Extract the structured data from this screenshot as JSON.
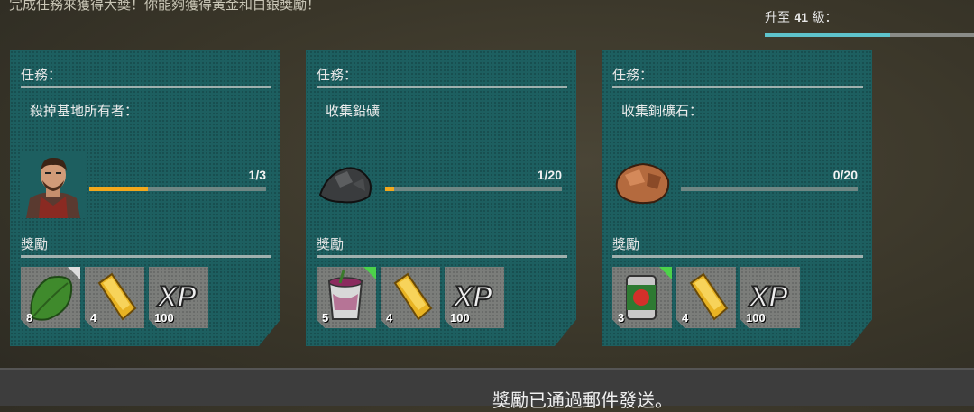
{
  "header": {
    "subtitle": "完成任務來獲得大獎！你能夠獲得黃金和白銀獎勵！",
    "level_prefix": "升至",
    "level_number": "41",
    "level_suffix": "級：",
    "level_progress": 0.6
  },
  "cards": [
    {
      "task_title": "任務：",
      "task_desc": "殺掉基地所有者：",
      "target_icon": "survivor-portrait-icon",
      "progress_text": "1/3",
      "progress": 0.333,
      "reward_title": "獎勵",
      "rewards": [
        {
          "icon": "spinach-leaf-icon",
          "qty": "8",
          "corner": "white"
        },
        {
          "icon": "gold-bar-icon",
          "qty": "4",
          "corner": ""
        },
        {
          "icon": "xp-icon",
          "qty": "100",
          "corner": ""
        }
      ]
    },
    {
      "task_title": "任務：",
      "task_desc": "收集鉛礦",
      "target_icon": "lead-ore-icon",
      "progress_text": "1/20",
      "progress": 0.05,
      "reward_title": "獎勵",
      "rewards": [
        {
          "icon": "berry-drink-can-icon",
          "qty": "5",
          "corner": "green"
        },
        {
          "icon": "gold-bar-icon",
          "qty": "4",
          "corner": ""
        },
        {
          "icon": "xp-icon",
          "qty": "100",
          "corner": ""
        }
      ]
    },
    {
      "task_title": "任務：",
      "task_desc": "收集銅礦石：",
      "target_icon": "copper-ore-icon",
      "progress_text": "0/20",
      "progress": 0,
      "reward_title": "獎勵",
      "rewards": [
        {
          "icon": "canned-tomato-icon",
          "qty": "3",
          "corner": "green"
        },
        {
          "icon": "gold-bar-icon",
          "qty": "4",
          "corner": ""
        },
        {
          "icon": "xp-icon",
          "qty": "100",
          "corner": ""
        }
      ]
    }
  ],
  "footer": {
    "message": "獎勵已通過郵件發送。"
  },
  "xp_label": "XP"
}
